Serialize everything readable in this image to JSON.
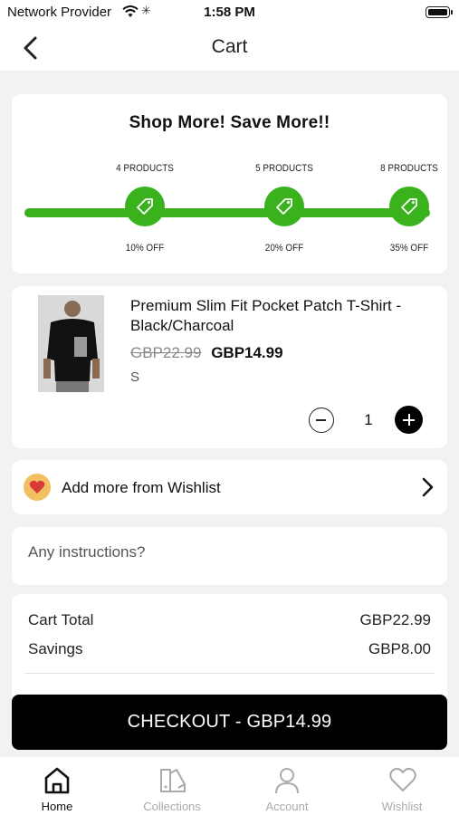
{
  "status_bar": {
    "carrier": "Network Provider",
    "time": "1:58 PM"
  },
  "header": {
    "title": "Cart"
  },
  "promo": {
    "heading": "Shop More! Save More!!",
    "milestones": [
      {
        "tier": "4 PRODUCTS",
        "discount": "10% OFF"
      },
      {
        "tier": "5 PRODUCTS",
        "discount": "20% OFF"
      },
      {
        "tier": "8 PRODUCTS",
        "discount": "35% OFF"
      }
    ],
    "accent_color": "#39b21d"
  },
  "cart_item": {
    "name": "Premium Slim Fit Pocket Patch T-Shirt - Black/Charcoal",
    "original_price": "GBP22.99",
    "price": "GBP14.99",
    "size": "S",
    "quantity": "1"
  },
  "wishlist_row": {
    "label": "Add more from Wishlist"
  },
  "instructions": {
    "placeholder": "Any instructions?"
  },
  "summary": {
    "cart_total_label": "Cart Total",
    "cart_total_value": "GBP22.99",
    "savings_label": "Savings",
    "savings_value": "GBP8.00"
  },
  "checkout": {
    "label": "CHECKOUT - GBP14.99"
  },
  "tabs": [
    {
      "label": "Home",
      "icon": "home-icon",
      "active": true
    },
    {
      "label": "Collections",
      "icon": "collections-icon",
      "active": false
    },
    {
      "label": "Account",
      "icon": "account-icon",
      "active": false
    },
    {
      "label": "Wishlist",
      "icon": "heart-icon",
      "active": false
    }
  ]
}
